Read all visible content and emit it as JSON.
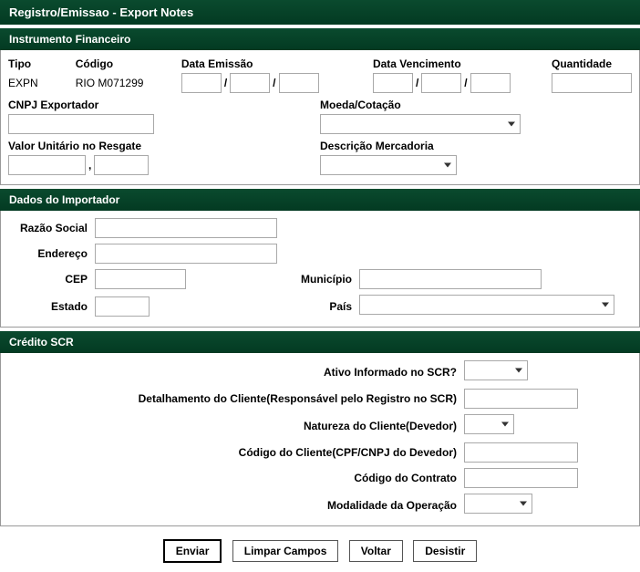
{
  "header": "Registro/Emissao - Export Notes",
  "instrumento": {
    "section": "Instrumento Financeiro",
    "tipo_label": "Tipo",
    "tipo_value": "EXPN",
    "codigo_label": "Código",
    "codigo_value": "RIO M071299",
    "data_emissao_label": "Data Emissão",
    "data_emissao": {
      "d": "",
      "m": "",
      "y": ""
    },
    "data_venc_label": "Data Vencimento",
    "data_venc": {
      "d": "",
      "m": "",
      "y": ""
    },
    "quantidade_label": "Quantidade",
    "quantidade_value": "",
    "cnpj_label": "CNPJ Exportador",
    "cnpj_value": "",
    "moeda_label": "Moeda/Cotação",
    "moeda_value": "",
    "valor_unit_label": "Valor Unitário no Resgate",
    "valor_unit_int": "",
    "valor_unit_dec": "",
    "descricao_label": "Descrição Mercadoria",
    "descricao_value": ""
  },
  "importador": {
    "section": "Dados do Importador",
    "razao_label": "Razão Social",
    "razao_value": "",
    "endereco_label": "Endereço",
    "endereco_value": "",
    "cep_label": "CEP",
    "cep_value": "",
    "municipio_label": "Município",
    "municipio_value": "",
    "estado_label": "Estado",
    "estado_value": "",
    "pais_label": "País",
    "pais_value": ""
  },
  "scr": {
    "section": "Crédito SCR",
    "ativo_label": "Ativo Informado no SCR?",
    "ativo_value": "",
    "detalhamento_label": "Detalhamento do Cliente(Responsável pelo Registro no SCR)",
    "detalhamento_value": "",
    "natureza_label": "Natureza do Cliente(Devedor)",
    "natureza_value": "",
    "codigo_cliente_label": "Código do Cliente(CPF/CNPJ do Devedor)",
    "codigo_cliente_value": "",
    "codigo_contrato_label": "Código do Contrato",
    "codigo_contrato_value": "",
    "modalidade_label": "Modalidade da Operação",
    "modalidade_value": ""
  },
  "buttons": {
    "enviar": "Enviar",
    "limpar": "Limpar Campos",
    "voltar": "Voltar",
    "desistir": "Desistir"
  },
  "chart_data": null
}
